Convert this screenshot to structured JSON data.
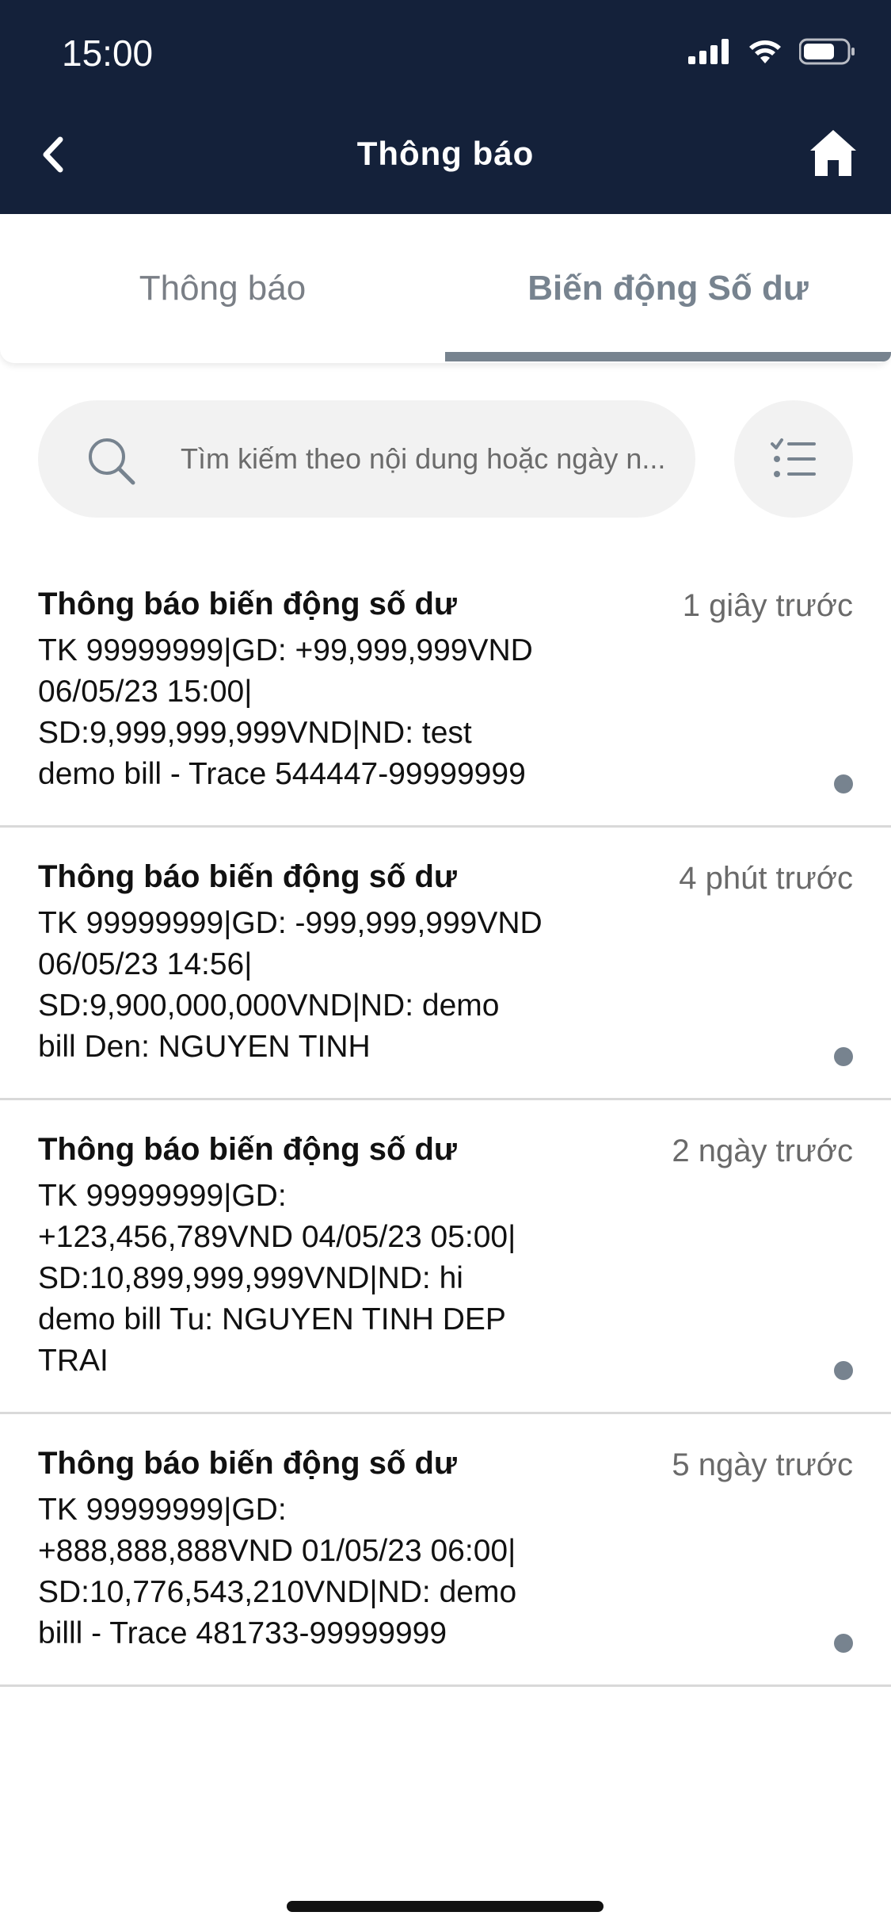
{
  "status_bar": {
    "time": "15:00"
  },
  "header": {
    "title": "Thông báo"
  },
  "tabs": [
    {
      "label": "Thông báo",
      "active": false
    },
    {
      "label": "Biến động Số dư",
      "active": true
    }
  ],
  "search": {
    "placeholder": "Tìm kiếm theo nội dung hoặc ngày n..."
  },
  "notifications": [
    {
      "title": "Thông báo biến động số dư",
      "time": "1 giây trước",
      "body": "TK 99999999|GD: +99,999,999VND 06/05/23 15:00| SD:9,999,999,999VND|ND: test demo bill - Trace 544447-99999999"
    },
    {
      "title": "Thông báo biến động số dư",
      "time": "4 phút trước",
      "body": "TK 99999999|GD: -999,999,999VND 06/05/23 14:56| SD:9,900,000,000VND|ND: demo bill Den: NGUYEN TINH"
    },
    {
      "title": "Thông báo biến động số dư",
      "time": "2 ngày trước",
      "body": "TK 99999999|GD: +123,456,789VND 04/05/23 05:00| SD:10,899,999,999VND|ND: hi demo bill Tu: NGUYEN TINH DEP TRAI"
    },
    {
      "title": "Thông báo biến động số dư",
      "time": "5 ngày trước",
      "body": "TK 99999999|GD: +888,888,888VND 01/05/23 06:00| SD:10,776,543,210VND|ND: demo billl - Trace 481733-99999999"
    }
  ],
  "colors": {
    "header_bg": "#14213a",
    "accent": "#77838f",
    "unread_dot": "#77838f"
  }
}
